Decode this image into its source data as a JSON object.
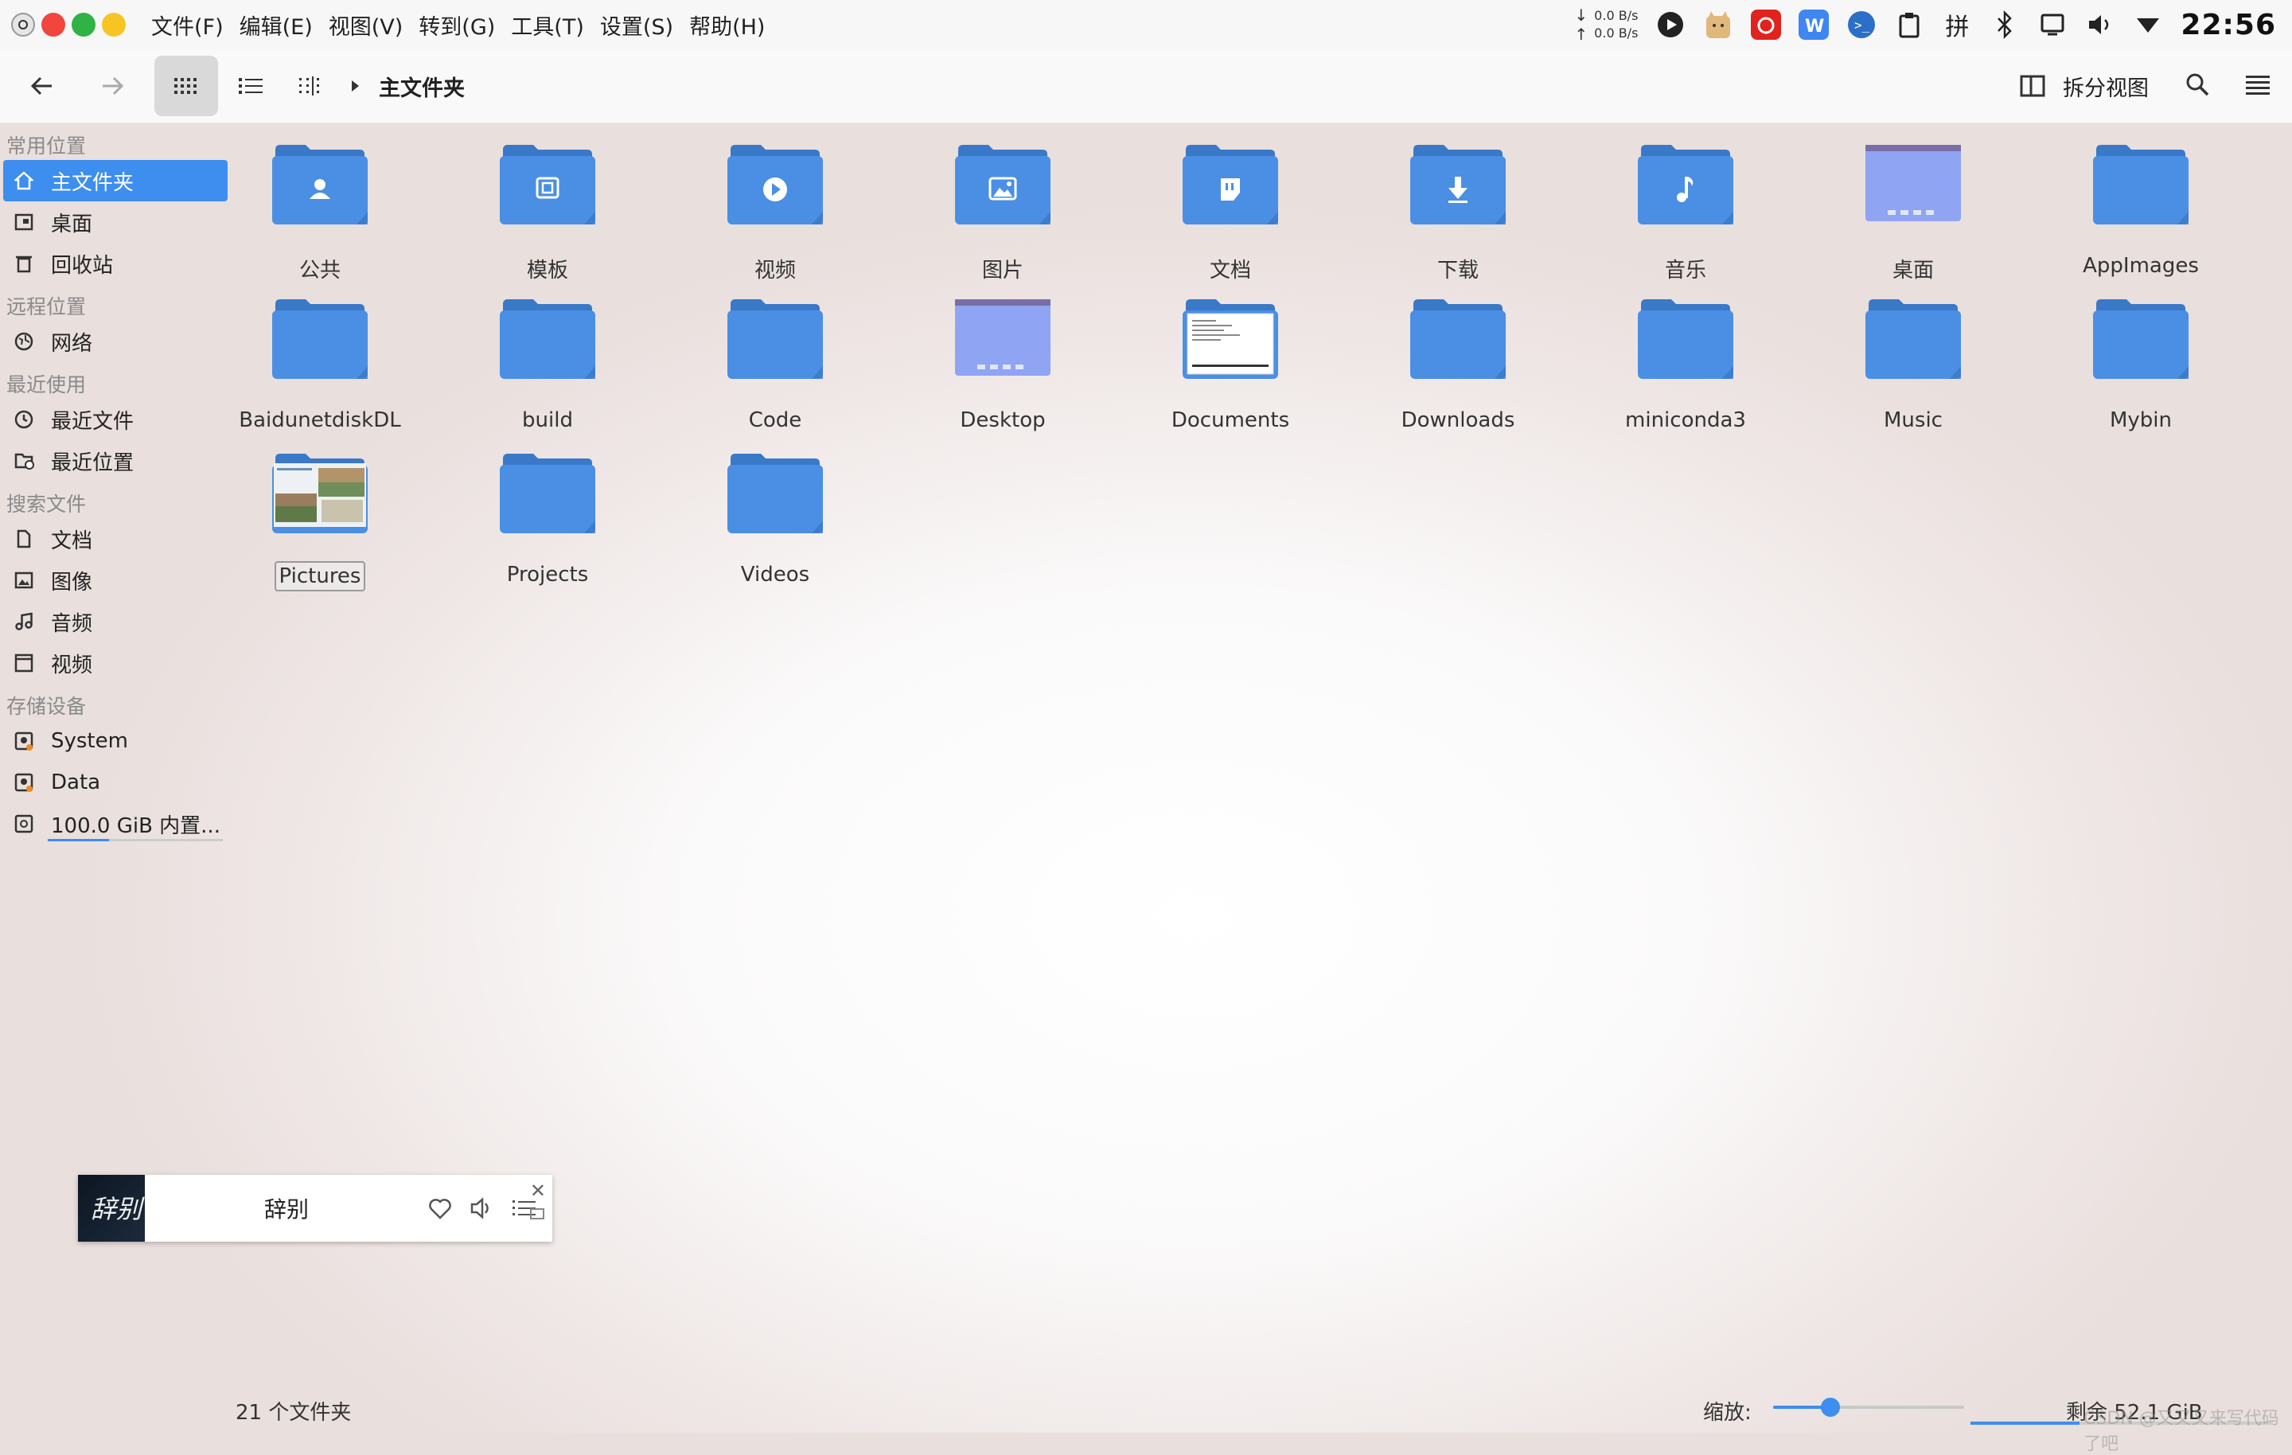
{
  "menu": [
    "文件(F)",
    "编辑(E)",
    "视图(V)",
    "转到(G)",
    "工具(T)",
    "设置(S)",
    "帮助(H)"
  ],
  "tray": {
    "down_speed": "0.0 B/s",
    "up_speed": "0.0 B/s",
    "time": "22:56",
    "input_method": "拼"
  },
  "toolbar": {
    "breadcrumb": "主文件夹",
    "split_label": "拆分视图"
  },
  "sidebar": {
    "sections": [
      {
        "title": "常用位置",
        "items": [
          {
            "label": "主文件夹",
            "icon": "home-icon",
            "active": true
          },
          {
            "label": "桌面",
            "icon": "desktop-icon"
          },
          {
            "label": "回收站",
            "icon": "trash-icon"
          }
        ]
      },
      {
        "title": "远程位置",
        "items": [
          {
            "label": "网络",
            "icon": "network-icon"
          }
        ]
      },
      {
        "title": "最近使用",
        "items": [
          {
            "label": "最近文件",
            "icon": "recent-clock-icon"
          },
          {
            "label": "最近位置",
            "icon": "recent-folder-icon"
          }
        ]
      },
      {
        "title": "搜索文件",
        "items": [
          {
            "label": "文档",
            "icon": "document-icon"
          },
          {
            "label": "图像",
            "icon": "image-icon"
          },
          {
            "label": "音频",
            "icon": "music-note-icon"
          },
          {
            "label": "视频",
            "icon": "video-icon"
          }
        ]
      },
      {
        "title": "存储设备",
        "items": [
          {
            "label": "System",
            "icon": "drive-icon"
          },
          {
            "label": "Data",
            "icon": "drive-icon"
          },
          {
            "label": "100.0 GiB 内置...",
            "icon": "disk-icon",
            "usage": 0.35
          }
        ]
      }
    ]
  },
  "files": [
    {
      "name": "公共",
      "type": "public"
    },
    {
      "name": "模板",
      "type": "templates"
    },
    {
      "name": "视频",
      "type": "videos"
    },
    {
      "name": "图片",
      "type": "pictures"
    },
    {
      "name": "文档",
      "type": "documents"
    },
    {
      "name": "下载",
      "type": "download"
    },
    {
      "name": "音乐",
      "type": "music"
    },
    {
      "name": "桌面",
      "type": "desktop-folder"
    },
    {
      "name": "AppImages",
      "type": "folder"
    },
    {
      "name": "BaidunetdiskDL",
      "type": "folder"
    },
    {
      "name": "build",
      "type": "folder"
    },
    {
      "name": "Code",
      "type": "folder"
    },
    {
      "name": "Desktop",
      "type": "desktop-folder"
    },
    {
      "name": "Documents",
      "type": "doc-preview"
    },
    {
      "name": "Downloads",
      "type": "folder"
    },
    {
      "name": "miniconda3",
      "type": "folder"
    },
    {
      "name": "Music",
      "type": "folder"
    },
    {
      "name": "Mybin",
      "type": "folder"
    },
    {
      "name": "Pictures",
      "type": "photo-preview",
      "selected": true
    },
    {
      "name": "Projects",
      "type": "folder"
    },
    {
      "name": "Videos",
      "type": "folder"
    }
  ],
  "music_player": {
    "song": "辞别",
    "cover_text": "辞别"
  },
  "status": {
    "count": "21 个文件夹",
    "zoom_label": "缩放:",
    "zoom_level": 0.3,
    "free_space": "剩余 52.1 GiB",
    "disk_usage": 0.36,
    "watermark": "CSDN @又又又来写代码了吧"
  },
  "colors": {
    "accent": "#3d8eef",
    "folder": "#4a8fe3",
    "folder_dark": "#3a78c8"
  }
}
